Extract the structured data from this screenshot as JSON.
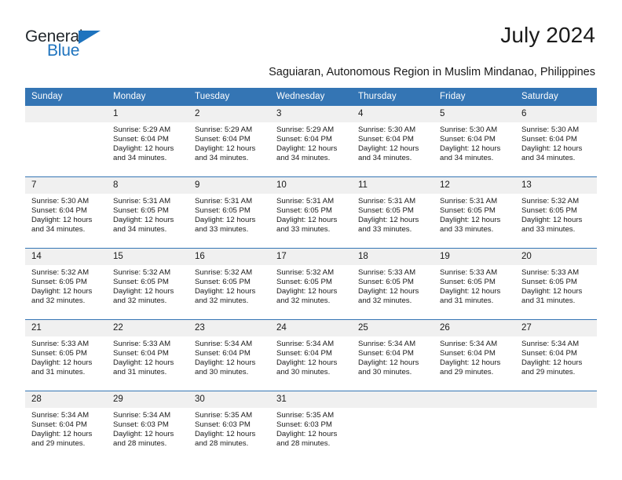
{
  "brand": {
    "name_part1": "General",
    "name_part2": "Blue",
    "accent_color": "#1e73be",
    "triangle_icon": "brand-triangle-icon"
  },
  "header": {
    "month_title": "July 2024",
    "location_subtitle": "Saguiaran, Autonomous Region in Muslim Mindanao, Philippines"
  },
  "calendar": {
    "header_bg": "#3475b4",
    "daynum_bg": "#f0f0f0",
    "weekday_headers": [
      "Sunday",
      "Monday",
      "Tuesday",
      "Wednesday",
      "Thursday",
      "Friday",
      "Saturday"
    ],
    "weeks": [
      [
        {
          "day": "",
          "sunrise": "",
          "sunset": "",
          "daylight_line1": "",
          "daylight_line2": "",
          "empty": true
        },
        {
          "day": "1",
          "sunrise": "Sunrise: 5:29 AM",
          "sunset": "Sunset: 6:04 PM",
          "daylight_line1": "Daylight: 12 hours",
          "daylight_line2": "and 34 minutes."
        },
        {
          "day": "2",
          "sunrise": "Sunrise: 5:29 AM",
          "sunset": "Sunset: 6:04 PM",
          "daylight_line1": "Daylight: 12 hours",
          "daylight_line2": "and 34 minutes."
        },
        {
          "day": "3",
          "sunrise": "Sunrise: 5:29 AM",
          "sunset": "Sunset: 6:04 PM",
          "daylight_line1": "Daylight: 12 hours",
          "daylight_line2": "and 34 minutes."
        },
        {
          "day": "4",
          "sunrise": "Sunrise: 5:30 AM",
          "sunset": "Sunset: 6:04 PM",
          "daylight_line1": "Daylight: 12 hours",
          "daylight_line2": "and 34 minutes."
        },
        {
          "day": "5",
          "sunrise": "Sunrise: 5:30 AM",
          "sunset": "Sunset: 6:04 PM",
          "daylight_line1": "Daylight: 12 hours",
          "daylight_line2": "and 34 minutes."
        },
        {
          "day": "6",
          "sunrise": "Sunrise: 5:30 AM",
          "sunset": "Sunset: 6:04 PM",
          "daylight_line1": "Daylight: 12 hours",
          "daylight_line2": "and 34 minutes."
        }
      ],
      [
        {
          "day": "7",
          "sunrise": "Sunrise: 5:30 AM",
          "sunset": "Sunset: 6:04 PM",
          "daylight_line1": "Daylight: 12 hours",
          "daylight_line2": "and 34 minutes."
        },
        {
          "day": "8",
          "sunrise": "Sunrise: 5:31 AM",
          "sunset": "Sunset: 6:05 PM",
          "daylight_line1": "Daylight: 12 hours",
          "daylight_line2": "and 34 minutes."
        },
        {
          "day": "9",
          "sunrise": "Sunrise: 5:31 AM",
          "sunset": "Sunset: 6:05 PM",
          "daylight_line1": "Daylight: 12 hours",
          "daylight_line2": "and 33 minutes."
        },
        {
          "day": "10",
          "sunrise": "Sunrise: 5:31 AM",
          "sunset": "Sunset: 6:05 PM",
          "daylight_line1": "Daylight: 12 hours",
          "daylight_line2": "and 33 minutes."
        },
        {
          "day": "11",
          "sunrise": "Sunrise: 5:31 AM",
          "sunset": "Sunset: 6:05 PM",
          "daylight_line1": "Daylight: 12 hours",
          "daylight_line2": "and 33 minutes."
        },
        {
          "day": "12",
          "sunrise": "Sunrise: 5:31 AM",
          "sunset": "Sunset: 6:05 PM",
          "daylight_line1": "Daylight: 12 hours",
          "daylight_line2": "and 33 minutes."
        },
        {
          "day": "13",
          "sunrise": "Sunrise: 5:32 AM",
          "sunset": "Sunset: 6:05 PM",
          "daylight_line1": "Daylight: 12 hours",
          "daylight_line2": "and 33 minutes."
        }
      ],
      [
        {
          "day": "14",
          "sunrise": "Sunrise: 5:32 AM",
          "sunset": "Sunset: 6:05 PM",
          "daylight_line1": "Daylight: 12 hours",
          "daylight_line2": "and 32 minutes."
        },
        {
          "day": "15",
          "sunrise": "Sunrise: 5:32 AM",
          "sunset": "Sunset: 6:05 PM",
          "daylight_line1": "Daylight: 12 hours",
          "daylight_line2": "and 32 minutes."
        },
        {
          "day": "16",
          "sunrise": "Sunrise: 5:32 AM",
          "sunset": "Sunset: 6:05 PM",
          "daylight_line1": "Daylight: 12 hours",
          "daylight_line2": "and 32 minutes."
        },
        {
          "day": "17",
          "sunrise": "Sunrise: 5:32 AM",
          "sunset": "Sunset: 6:05 PM",
          "daylight_line1": "Daylight: 12 hours",
          "daylight_line2": "and 32 minutes."
        },
        {
          "day": "18",
          "sunrise": "Sunrise: 5:33 AM",
          "sunset": "Sunset: 6:05 PM",
          "daylight_line1": "Daylight: 12 hours",
          "daylight_line2": "and 32 minutes."
        },
        {
          "day": "19",
          "sunrise": "Sunrise: 5:33 AM",
          "sunset": "Sunset: 6:05 PM",
          "daylight_line1": "Daylight: 12 hours",
          "daylight_line2": "and 31 minutes."
        },
        {
          "day": "20",
          "sunrise": "Sunrise: 5:33 AM",
          "sunset": "Sunset: 6:05 PM",
          "daylight_line1": "Daylight: 12 hours",
          "daylight_line2": "and 31 minutes."
        }
      ],
      [
        {
          "day": "21",
          "sunrise": "Sunrise: 5:33 AM",
          "sunset": "Sunset: 6:05 PM",
          "daylight_line1": "Daylight: 12 hours",
          "daylight_line2": "and 31 minutes."
        },
        {
          "day": "22",
          "sunrise": "Sunrise: 5:33 AM",
          "sunset": "Sunset: 6:04 PM",
          "daylight_line1": "Daylight: 12 hours",
          "daylight_line2": "and 31 minutes."
        },
        {
          "day": "23",
          "sunrise": "Sunrise: 5:34 AM",
          "sunset": "Sunset: 6:04 PM",
          "daylight_line1": "Daylight: 12 hours",
          "daylight_line2": "and 30 minutes."
        },
        {
          "day": "24",
          "sunrise": "Sunrise: 5:34 AM",
          "sunset": "Sunset: 6:04 PM",
          "daylight_line1": "Daylight: 12 hours",
          "daylight_line2": "and 30 minutes."
        },
        {
          "day": "25",
          "sunrise": "Sunrise: 5:34 AM",
          "sunset": "Sunset: 6:04 PM",
          "daylight_line1": "Daylight: 12 hours",
          "daylight_line2": "and 30 minutes."
        },
        {
          "day": "26",
          "sunrise": "Sunrise: 5:34 AM",
          "sunset": "Sunset: 6:04 PM",
          "daylight_line1": "Daylight: 12 hours",
          "daylight_line2": "and 29 minutes."
        },
        {
          "day": "27",
          "sunrise": "Sunrise: 5:34 AM",
          "sunset": "Sunset: 6:04 PM",
          "daylight_line1": "Daylight: 12 hours",
          "daylight_line2": "and 29 minutes."
        }
      ],
      [
        {
          "day": "28",
          "sunrise": "Sunrise: 5:34 AM",
          "sunset": "Sunset: 6:04 PM",
          "daylight_line1": "Daylight: 12 hours",
          "daylight_line2": "and 29 minutes."
        },
        {
          "day": "29",
          "sunrise": "Sunrise: 5:34 AM",
          "sunset": "Sunset: 6:03 PM",
          "daylight_line1": "Daylight: 12 hours",
          "daylight_line2": "and 28 minutes."
        },
        {
          "day": "30",
          "sunrise": "Sunrise: 5:35 AM",
          "sunset": "Sunset: 6:03 PM",
          "daylight_line1": "Daylight: 12 hours",
          "daylight_line2": "and 28 minutes."
        },
        {
          "day": "31",
          "sunrise": "Sunrise: 5:35 AM",
          "sunset": "Sunset: 6:03 PM",
          "daylight_line1": "Daylight: 12 hours",
          "daylight_line2": "and 28 minutes."
        },
        {
          "day": "",
          "sunrise": "",
          "sunset": "",
          "daylight_line1": "",
          "daylight_line2": "",
          "empty": true
        },
        {
          "day": "",
          "sunrise": "",
          "sunset": "",
          "daylight_line1": "",
          "daylight_line2": "",
          "empty": true
        },
        {
          "day": "",
          "sunrise": "",
          "sunset": "",
          "daylight_line1": "",
          "daylight_line2": "",
          "empty": true
        }
      ]
    ]
  }
}
